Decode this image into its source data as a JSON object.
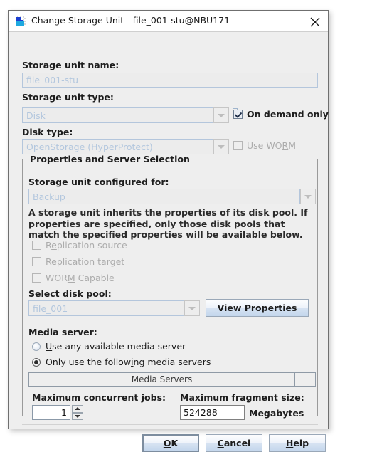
{
  "window": {
    "title": "Change Storage Unit - file_001-stu@NBU171",
    "icon": "storage-unit-icon",
    "close_label": "close-icon"
  },
  "form": {
    "storage_unit_name_label": "Storage unit name:",
    "storage_unit_name_value": "file_001-stu",
    "storage_unit_type_label": "Storage unit type:",
    "storage_unit_type_value": "Disk",
    "on_demand_only_label": "On demand only",
    "on_demand_only_checked": true,
    "disk_type_label": "Disk type:",
    "disk_type_value": "OpenStorage (HyperProtect)",
    "use_worm_label": "Use WORM",
    "use_worm_checked": false
  },
  "group": {
    "title": "Properties and Server Selection",
    "configured_for_label": "Storage unit configured for:",
    "configured_for_value": "Backup",
    "description": "A storage unit inherits the properties of its disk pool. If properties are specified, only those disk pools that match the specified properties will be available below.",
    "properties": [
      {
        "label": "Replication source",
        "checked": false
      },
      {
        "label": "Replication target",
        "checked": false
      },
      {
        "label": "WORM Capable",
        "checked": false
      }
    ],
    "select_disk_pool_label": "Select disk pool:",
    "select_disk_pool_value": "file_001",
    "view_properties_label": "View Properties",
    "media_server_label": "Media server:",
    "radio_any_label": "Use any available media server",
    "radio_only_label": "Only use the following media servers",
    "radio_selected": "only",
    "media_servers_table": {
      "column": "Media Servers",
      "rows": []
    },
    "max_concurrent_jobs_label": "Maximum concurrent jobs:",
    "max_concurrent_jobs_value": "1",
    "max_fragment_size_label": "Maximum fragment size:",
    "max_fragment_size_value": "524288",
    "megabytes_label": "Megabytes"
  },
  "buttons": {
    "ok": "OK",
    "cancel": "Cancel",
    "help": "Help"
  },
  "colors": {
    "dialog_bg": "#eeeeee",
    "titlebar_bg": "#ffffff",
    "disabled_text": "#b3c7de",
    "button_accent": "#c3d6ec"
  }
}
